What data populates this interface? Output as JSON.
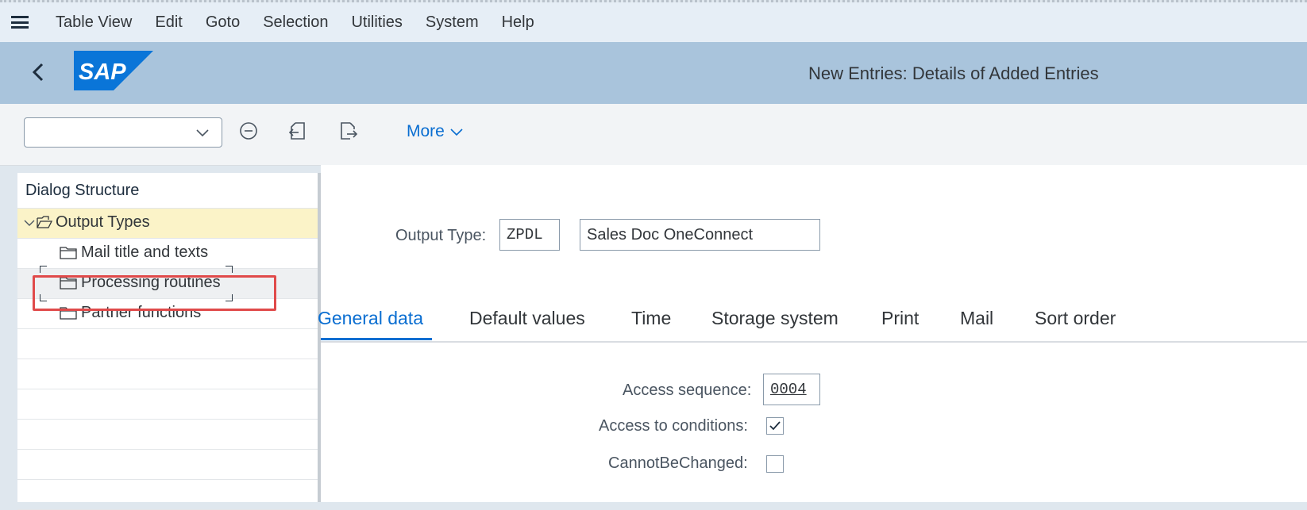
{
  "menu": {
    "items": [
      "Table View",
      "Edit",
      "Goto",
      "Selection",
      "Utilities",
      "System",
      "Help"
    ]
  },
  "header": {
    "logo_text": "SAP",
    "title": "New Entries: Details of Added Entries"
  },
  "toolbar": {
    "select_value": "",
    "more_label": "More"
  },
  "dialog_structure": {
    "title": "Dialog Structure",
    "items": [
      {
        "label": "Output Types"
      },
      {
        "label": "Mail title and texts"
      },
      {
        "label": "Processing routines"
      },
      {
        "label": "Partner functions"
      }
    ]
  },
  "form": {
    "output_type_label": "Output Type:",
    "output_type_code": "ZPDL",
    "output_type_desc": "Sales Doc OneConnect",
    "tabs": [
      "General data",
      "Default values",
      "Time",
      "Storage system",
      "Print",
      "Mail",
      "Sort order"
    ],
    "access_sequence_label": "Access sequence:",
    "access_sequence_value": "0004",
    "access_conditions_label": "Access to conditions:",
    "access_conditions_checked": true,
    "cannot_be_changed_label": "CannotBeChanged:",
    "cannot_be_changed_checked": false
  },
  "colors": {
    "accent": "#0a6ed1",
    "header_bg": "#a9c4dc",
    "selected_row": "#fbf3c8",
    "highlight_box": "#e04a4a"
  }
}
